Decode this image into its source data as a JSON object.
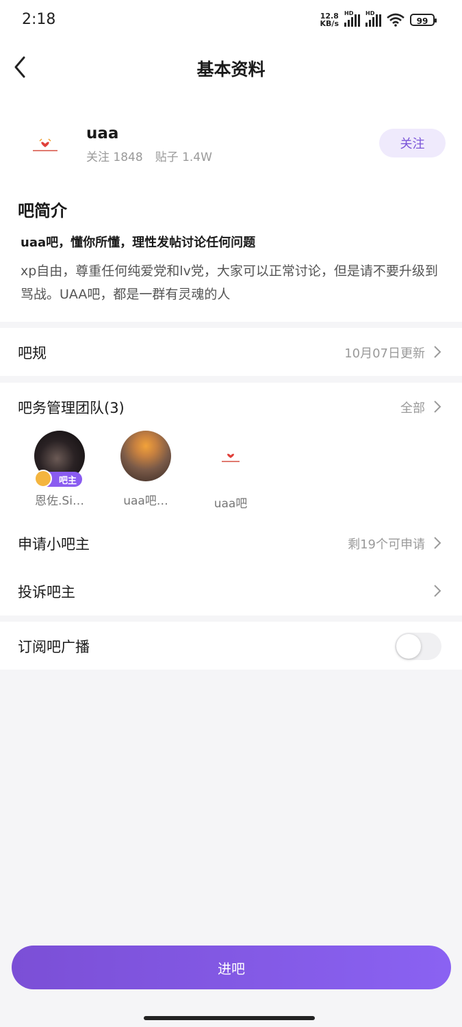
{
  "status_bar": {
    "time": "2:18",
    "net_speed_value": "12.8",
    "net_speed_unit": "KB/s",
    "signal1_label": "HD",
    "signal2_label": "HD",
    "battery": "99"
  },
  "header": {
    "title": "基本资料"
  },
  "forum": {
    "name": "uaa",
    "follow_count": "关注 1848",
    "post_count": "贴子 1.4W",
    "follow_label": "关注"
  },
  "intro": {
    "heading": "吧简介",
    "summary": "uaa吧，懂你所懂，理性发帖讨论任何问题",
    "description": "xp自由，尊重任何纯爱党和lv党，大家可以正常讨论，但是请不要升级到骂战。UAA吧，都是一群有灵魂的人"
  },
  "rules": {
    "label": "吧规",
    "updated": "10月07日更新"
  },
  "team": {
    "label": "吧务管理团队(3)",
    "all_label": "全部",
    "members": [
      {
        "name": "恩佐.Si…",
        "badge": "吧主"
      },
      {
        "name": "uaa吧…"
      },
      {
        "name": "uaa吧"
      }
    ]
  },
  "apply": {
    "label": "申请小吧主",
    "remaining": "剩19个可申请"
  },
  "report": {
    "label": "投诉吧主"
  },
  "subscribe": {
    "label": "订阅吧广播",
    "enabled": false
  },
  "enter_button": "进吧",
  "colors": {
    "accent": "#8a5cf0",
    "follow_bg": "#efeafc",
    "follow_text": "#7a54d8"
  }
}
